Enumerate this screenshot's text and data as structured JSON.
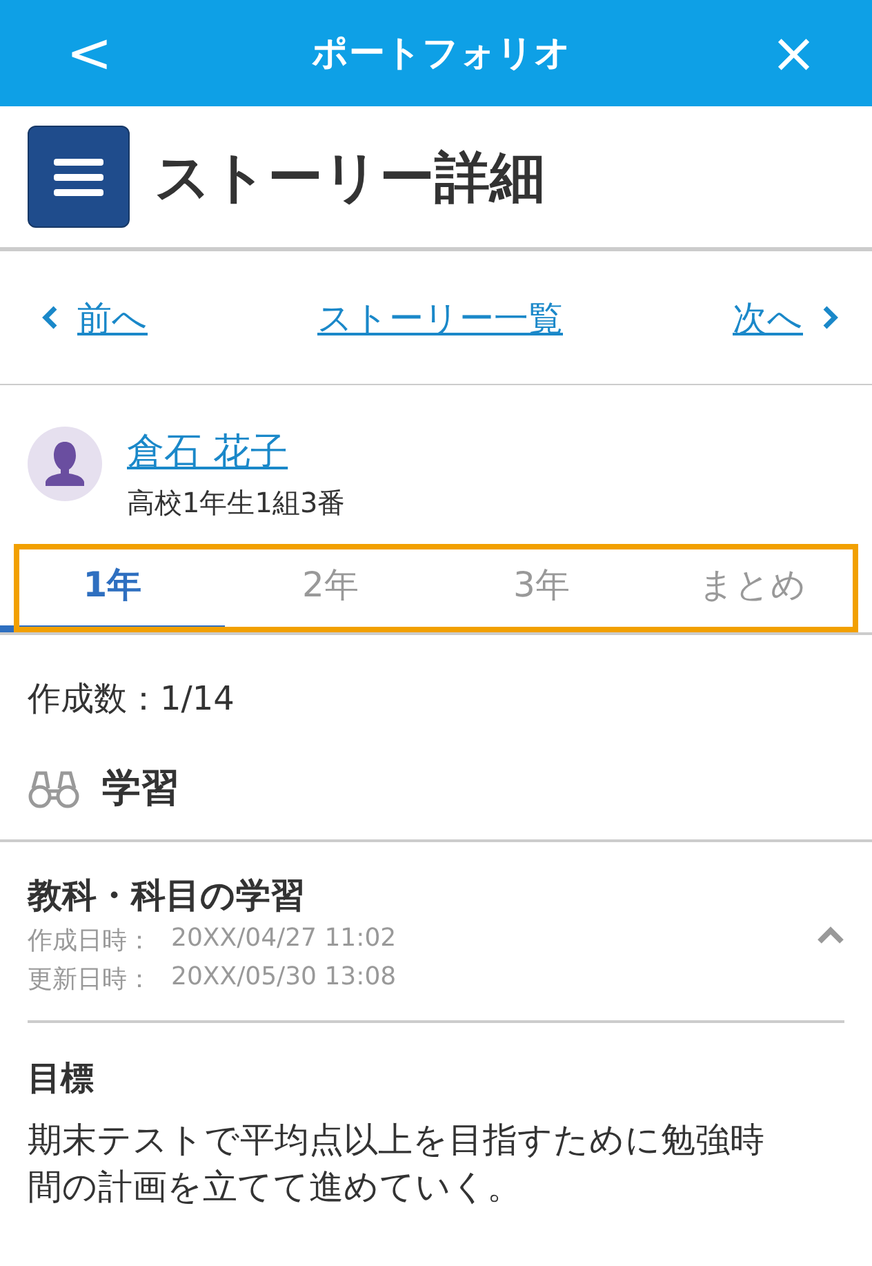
{
  "header": {
    "back": "<",
    "title": "ポートフォリオ",
    "close": "×"
  },
  "page_title": "ストーリー詳細",
  "nav": {
    "prev": "前へ",
    "list": "ストーリー一覧",
    "next": "次へ"
  },
  "student": {
    "name": "倉石 花子",
    "class": "高校1年生1組3番"
  },
  "tabs_highlighted": true,
  "tabs": [
    {
      "label": "1年",
      "selected": true
    },
    {
      "label": "2年",
      "selected": false
    },
    {
      "label": "3年",
      "selected": false
    },
    {
      "label": "まとめ",
      "selected": false
    }
  ],
  "count": "作成数：1/14",
  "section": "学習",
  "story": {
    "title": "教科・科目の学習",
    "expanded": true,
    "dates": [
      {
        "label": "作成日時：",
        "value": "20XX/04/27 11:02"
      },
      {
        "label": "更新日時：",
        "value": "20XX/05/30 13:08"
      }
    ],
    "goal_heading": "目標",
    "goal_text": "期末テストで平均点以上を目指すために勉強時間の計画を立てて進めていく。"
  }
}
